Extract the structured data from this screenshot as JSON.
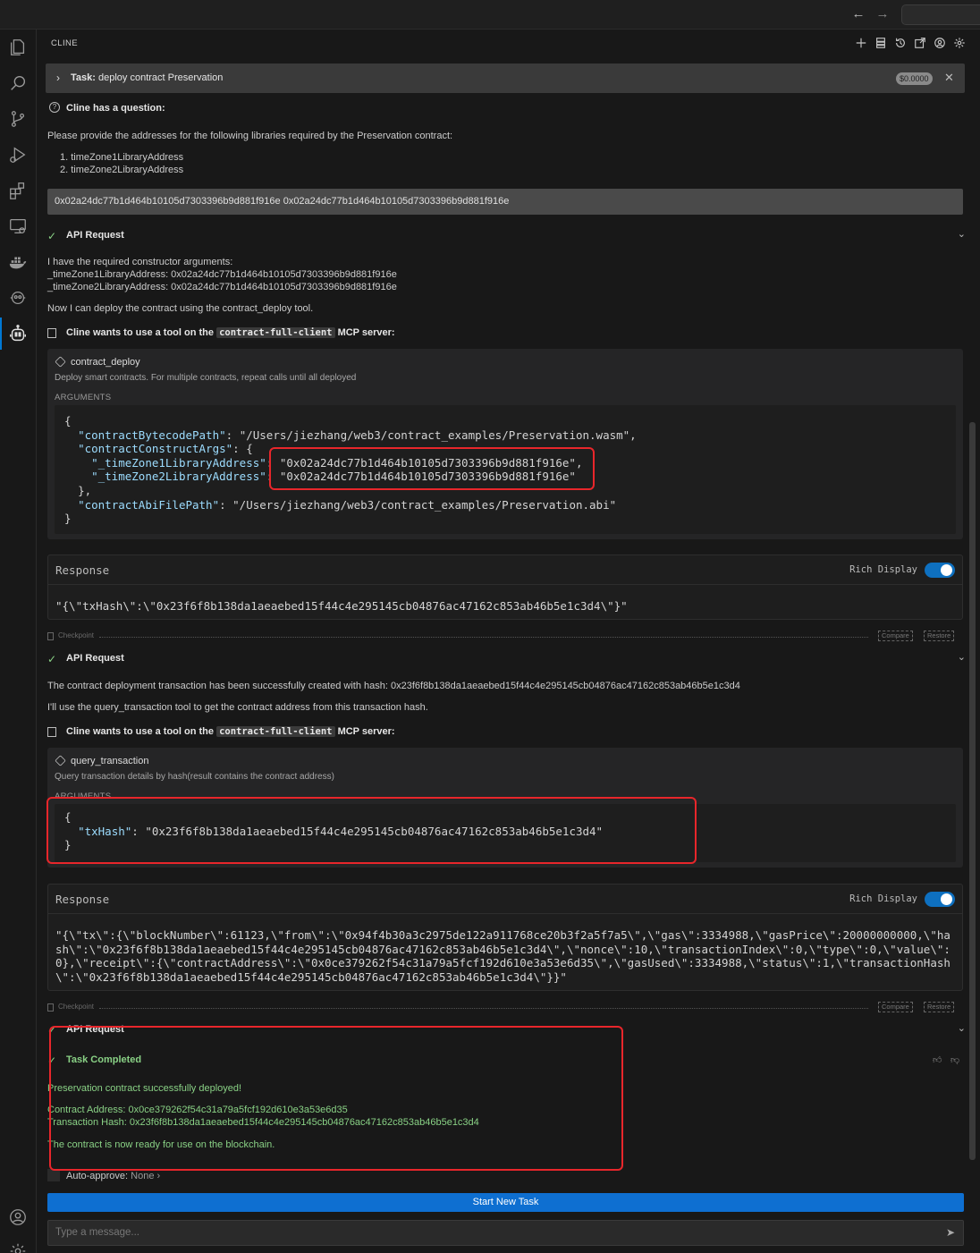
{
  "panel": {
    "title": "CLINE"
  },
  "task": {
    "label": "Task:",
    "text": "deploy contract Preservation",
    "cost": "$0.0000"
  },
  "question": {
    "title": "Cline has a question:",
    "prompt": "Please provide the addresses for the following libraries required by the Preservation contract:",
    "items": [
      "1. timeZone1LibraryAddress",
      "2. timeZone2LibraryAddress"
    ],
    "answer": "0x02a24dc77b1d464b10105d7303396b9d881f916e 0x02a24dc77b1d464b10105d7303396b9d881f916e"
  },
  "api1": {
    "title": "API Request",
    "lines": [
      "I have the required constructor arguments:",
      "_timeZone1LibraryAddress: 0x02a24dc77b1d464b10105d7303396b9d881f916e",
      "_timeZone2LibraryAddress: 0x02a24dc77b1d464b10105d7303396b9d881f916e"
    ],
    "next": "Now I can deploy the contract using the contract_deploy tool."
  },
  "mcp1": {
    "prefix": "Cline wants to use a tool on the",
    "server": "contract-full-client",
    "suffix": "MCP server:"
  },
  "tool1": {
    "name": "contract_deploy",
    "desc": "Deploy smart contracts. For multiple contracts, repeat calls until all deployed",
    "args_label": "ARGUMENTS",
    "code": {
      "l1": "{",
      "k2": "\"contractBytecodePath\"",
      "v2": ": \"/Users/jiezhang/web3/contract_examples/Preservation.wasm\",",
      "k3": "\"contractConstructArgs\"",
      "v3": ": {",
      "k4": "\"_timeZone1LibraryAddress\"",
      "v4": ": \"0x02a24dc77b1d464b10105d7303396b9d881f916e\",",
      "k5": "\"_timeZone2LibraryAddress\"",
      "v5": ": \"0x02a24dc77b1d464b10105d7303396b9d881f916e\"",
      "l6": "},",
      "k7": "\"contractAbiFilePath\"",
      "v7": ": \"/Users/jiezhang/web3/contract_examples/Preservation.abi\"",
      "l8": "}"
    }
  },
  "resp1": {
    "title": "Response",
    "rich": "Rich Display",
    "body": "\"{\\\"txHash\\\":\\\"0x23f6f8b138da1aeaebed15f44c4e295145cb04876ac47162c853ab46b5e1c3d4\\\"}\""
  },
  "checkpoint": {
    "label": "Checkpoint",
    "compare": "Compare",
    "restore": "Restore"
  },
  "api2": {
    "title": "API Request",
    "line1": "The contract deployment transaction has been successfully created with hash: 0x23f6f8b138da1aeaebed15f44c4e295145cb04876ac47162c853ab46b5e1c3d4",
    "line2": "I'll use the query_transaction tool to get the contract address from this transaction hash."
  },
  "mcp2": {
    "prefix": "Cline wants to use a tool on the",
    "server": "contract-full-client",
    "suffix": "MCP server:"
  },
  "tool2": {
    "name": "query_transaction",
    "desc": "Query transaction details by hash(result contains the contract address)",
    "args_label": "ARGUMENTS",
    "code": {
      "l1": "{",
      "k2": "\"txHash\"",
      "v2": ": \"0x23f6f8b138da1aeaebed15f44c4e295145cb04876ac47162c853ab46b5e1c3d4\"",
      "l3": "}"
    }
  },
  "resp2": {
    "title": "Response",
    "rich": "Rich Display",
    "lines": [
      "\"{\\\"tx\\\":{\\\"blockNumber\\\":61123,\\\"from\\\":\\\"0x94f4b30a3c2975de122a911768ce20b3f2a5f7a5\\\",\\\"gas\\\":3334988,\\\"gasPrice\\\":20000000000,\\\"ha",
      "sh\\\":\\\"0x23f6f8b138da1aeaebed15f44c4e295145cb04876ac47162c853ab46b5e1c3d4\\\",\\\"nonce\\\":10,\\\"transactionIndex\\\":0,\\\"type\\\":0,\\\"value\\\":",
      "0},\\\"receipt\\\":{\\\"contractAddress\\\":\\\"0x0ce379262f54c31a79a5fcf192d610e3a53e6d35\\\",\\\"gasUsed\\\":3334988,\\\"status\\\":1,\\\"transactionHash",
      "\\\":\\\"0x23f6f8b138da1aeaebed15f44c4e295145cb04876ac47162c853ab46b5e1c3d4\\\"}}\""
    ]
  },
  "api3": {
    "title": "API Request"
  },
  "completed": {
    "title": "Task Completed",
    "line1": "Preservation contract successfully deployed!",
    "line2": "Contract Address: 0x0ce379262f54c31a79a5fcf192d610e3a53e6d35",
    "line3": "Transaction Hash: 0x23f6f8b138da1aeaebed15f44c4e295145cb04876ac47162c853ab46b5e1c3d4",
    "line4": "The contract is now ready for use on the blockchain."
  },
  "auto_approve": {
    "label": "Auto-approve:",
    "value": "None"
  },
  "start_button": "Start New Task",
  "input": {
    "placeholder": "Type a message..."
  },
  "colors": {
    "accent": "#0e6fd1",
    "success": "#89d185",
    "highlight": "#e8262b"
  }
}
